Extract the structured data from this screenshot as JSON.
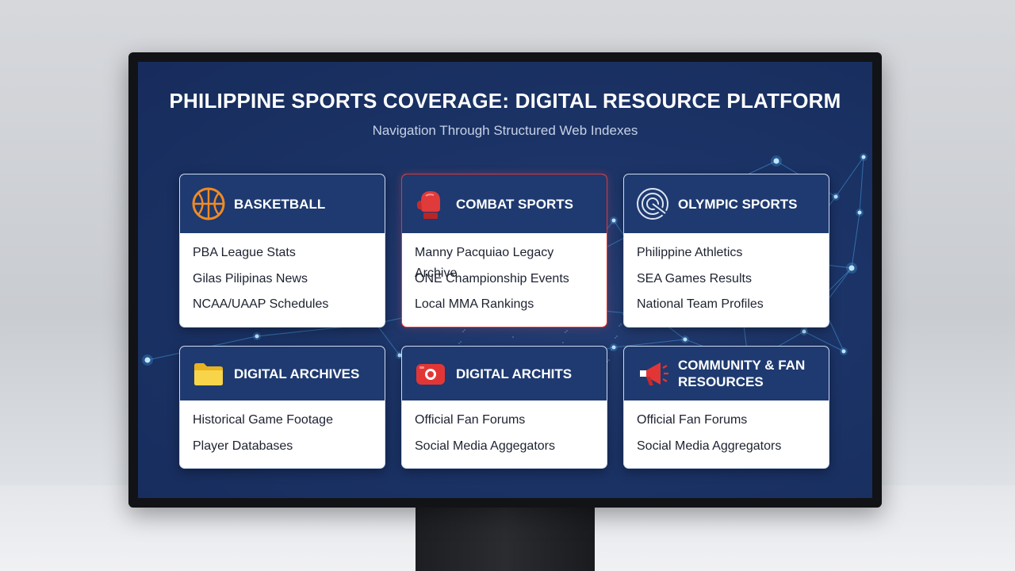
{
  "page": {
    "title": "PHILIPPINE SPORTS COVERAGE: DIGITAL RESOURCE PLATFORM",
    "subtitle": "Navigation Through Structured Web Indexes"
  },
  "cards": [
    {
      "title": "BASKETBALL",
      "icon": "basketball-icon",
      "items": [
        "PBA League Stats",
        "Gilas Pilipinas News",
        "NCAA/UAAP Schedules"
      ]
    },
    {
      "title": "COMBAT SPORTS",
      "icon": "boxing-glove-icon",
      "items": [
        "Manny Pacquiao Legacy Archive",
        "ONE Championship Events",
        "Local MMA Rankings"
      ]
    },
    {
      "title": "OLYMPIC SPORTS",
      "icon": "olympic-emblem-icon",
      "items": [
        "Philippine Athletics",
        "SEA Games Results",
        "National Team Profiles"
      ]
    },
    {
      "title": "DIGITAL ARCHIVES",
      "icon": "folder-icon",
      "items": [
        "Historical Game Footage",
        "Player Databases"
      ]
    },
    {
      "title": "DIGITAL ARCHITS",
      "icon": "camera-record-icon",
      "items": [
        "Official Fan Forums",
        "Social Media Aggegators"
      ]
    },
    {
      "title_line1": "COMMUNITY & FAN",
      "title_line2": "RESOURCES",
      "icon": "megaphone-icon",
      "items": [
        "Official Fan Forums",
        "Social Media Aggregators"
      ]
    }
  ],
  "colors": {
    "screen_bg": "#1b3366",
    "card_header": "#1e3a70",
    "accent_red": "#d63a3a",
    "network_glow": "#4fb6ff"
  }
}
